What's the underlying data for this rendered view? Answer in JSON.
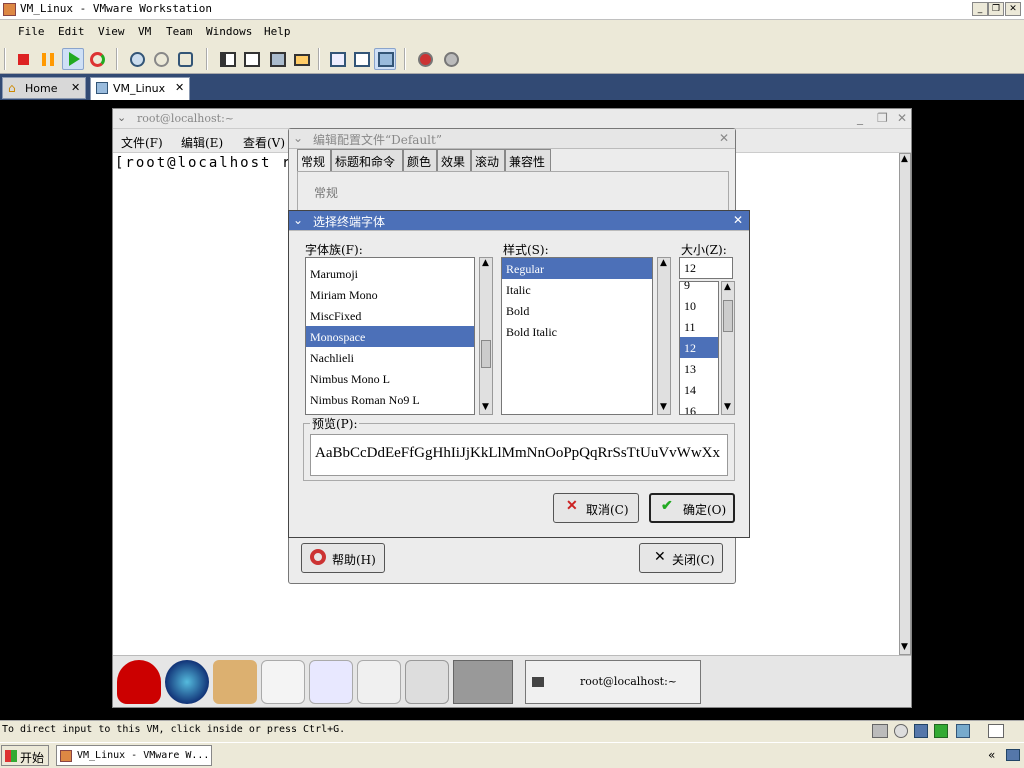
{
  "app": {
    "title": "VM_Linux - VMware Workstation"
  },
  "menubar": [
    "File",
    "Edit",
    "View",
    "VM",
    "Team",
    "Windows",
    "Help"
  ],
  "tabs": [
    {
      "label": "Home",
      "close": "✕"
    },
    {
      "label": "VM_Linux",
      "close": "✕"
    }
  ],
  "guest": {
    "terminal": {
      "title": "root@localhost:~",
      "menus": [
        "文件(F)",
        "编辑(E)",
        "查看(V)"
      ],
      "prompt": "[root@localhost root"
    },
    "config_dialog": {
      "title": "编辑配置文件“Default”",
      "tabs": [
        "常规",
        "标题和命令",
        "颜色",
        "效果",
        "滚动",
        "兼容性"
      ],
      "section": "常规",
      "help_button": "帮助(H)",
      "close_button": "关闭(C)"
    },
    "font_dialog": {
      "title": "选择终端字体",
      "family_label": "字体族(F):",
      "style_label": "样式(S):",
      "size_label": "大小(Z):",
      "families": [
        "Marumoji",
        "Miriam  Mono",
        "MiscFixed",
        "Monospace",
        "Nachlieli",
        "Nimbus  Mono  L",
        "Nimbus  Roman  No9  L"
      ],
      "selected_family": "Monospace",
      "styles": [
        "Regular",
        "Italic",
        "Bold",
        "Bold  Italic"
      ],
      "selected_style": "Regular",
      "size_value": "12",
      "sizes": [
        "9",
        "10",
        "11",
        "12",
        "13",
        "14",
        "16"
      ],
      "selected_size": "12",
      "preview_label": "预览(P):",
      "preview_text": "AaBbCcDdEeFfGgHhIiJjKkLlMmNnOoPpQqRrSsTtUuVvWwXx",
      "cancel_button": "取消(C)",
      "ok_button": "确定(O)"
    },
    "panel": {
      "task_label": "root@localhost:~"
    }
  },
  "statusbar": {
    "text": "To direct input to this VM, click inside or press Ctrl+G."
  },
  "taskbar": {
    "start": "开始",
    "items": [
      "VM_Linux - VMware W..."
    ]
  },
  "colors": {
    "selection": "#4c70b8",
    "tabbar": "#324a74",
    "dialog_title": "#4c70b8"
  }
}
